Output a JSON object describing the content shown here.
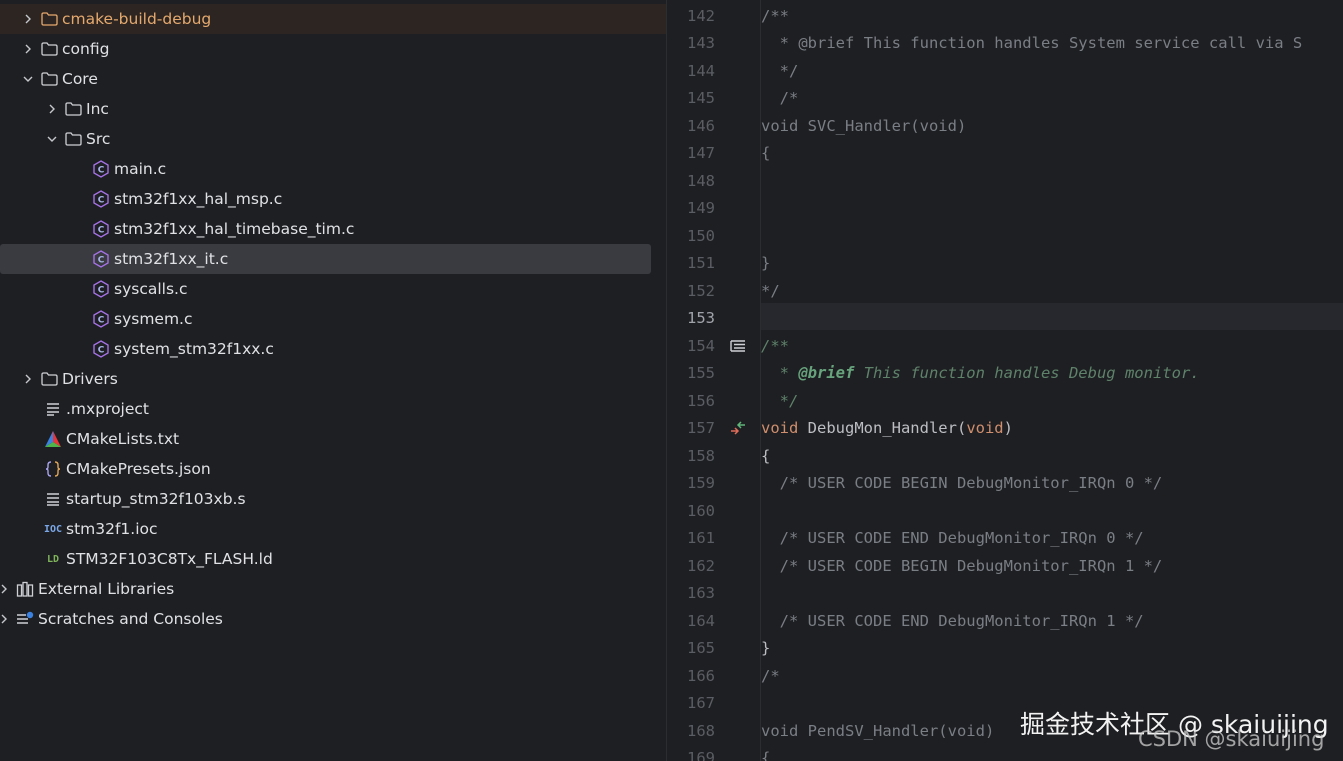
{
  "project_tree": {
    "items": [
      {
        "label": "cmake-build-debug",
        "icon": "folder-icon"
      },
      {
        "label": "config",
        "icon": "folder-icon"
      },
      {
        "label": "Core",
        "icon": "folder-icon"
      },
      {
        "label": "Inc",
        "icon": "folder-icon"
      },
      {
        "label": "Src",
        "icon": "folder-icon"
      },
      {
        "label": "main.c",
        "icon": "c-file-icon"
      },
      {
        "label": "stm32f1xx_hal_msp.c",
        "icon": "c-file-icon"
      },
      {
        "label": "stm32f1xx_hal_timebase_tim.c",
        "icon": "c-file-icon"
      },
      {
        "label": "stm32f1xx_it.c",
        "icon": "c-file-icon"
      },
      {
        "label": "syscalls.c",
        "icon": "c-file-icon"
      },
      {
        "label": "sysmem.c",
        "icon": "c-file-icon"
      },
      {
        "label": "system_stm32f1xx.c",
        "icon": "c-file-icon"
      },
      {
        "label": "Drivers",
        "icon": "folder-icon"
      },
      {
        "label": ".mxproject",
        "icon": "text-file-icon"
      },
      {
        "label": "CMakeLists.txt",
        "icon": "cmake-icon"
      },
      {
        "label": "CMakePresets.json",
        "icon": "json-file-icon"
      },
      {
        "label": "startup_stm32f103xb.s",
        "icon": "asm-file-icon"
      },
      {
        "label": "stm32f1.ioc",
        "icon": "ioc-file-icon"
      },
      {
        "label": "STM32F103C8Tx_FLASH.ld",
        "icon": "ld-file-icon"
      },
      {
        "label": "External Libraries",
        "icon": "library-icon"
      },
      {
        "label": "Scratches and Consoles",
        "icon": "scratches-icon"
      }
    ],
    "ioc_icon_text": "IOC",
    "ld_icon_text": "LD",
    "selected": "stm32f1xx_it.c"
  },
  "editor": {
    "current_line": "153",
    "lines": [
      {
        "n": "142",
        "text": "/**"
      },
      {
        "n": "143",
        "text": "  * @brief This function handles System service call via S"
      },
      {
        "n": "144",
        "text": "  */"
      },
      {
        "n": "145",
        "text": "  /*"
      },
      {
        "n": "146",
        "text": "void SVC_Handler(void)"
      },
      {
        "n": "147",
        "text": "{"
      },
      {
        "n": "148",
        "text": ""
      },
      {
        "n": "149",
        "text": ""
      },
      {
        "n": "150",
        "text": ""
      },
      {
        "n": "151",
        "text": "}"
      },
      {
        "n": "152",
        "text": "*/"
      },
      {
        "n": "153",
        "text": ""
      },
      {
        "n": "154",
        "text": "/**"
      },
      {
        "n": "155",
        "text": "  * @brief This function handles Debug monitor."
      },
      {
        "n": "156",
        "text": "  */"
      },
      {
        "n": "157",
        "text": "void DebugMon_Handler(void)"
      },
      {
        "n": "158",
        "text": "{"
      },
      {
        "n": "159",
        "text": "  /* USER CODE BEGIN DebugMonitor_IRQn 0 */"
      },
      {
        "n": "160",
        "text": ""
      },
      {
        "n": "161",
        "text": "  /* USER CODE END DebugMonitor_IRQn 0 */"
      },
      {
        "n": "162",
        "text": "  /* USER CODE BEGIN DebugMonitor_IRQn 1 */"
      },
      {
        "n": "163",
        "text": ""
      },
      {
        "n": "164",
        "text": "  /* USER CODE END DebugMonitor_IRQn 1 */"
      },
      {
        "n": "165",
        "text": "}"
      },
      {
        "n": "166",
        "text": "/*"
      },
      {
        "n": "167",
        "text": ""
      },
      {
        "n": "168",
        "text": "void PendSV_Handler(void)"
      },
      {
        "n": "169",
        "text": "{"
      }
    ],
    "colors": {
      "comment": "#7a7e85",
      "doc_comment": "#5f826b",
      "keyword": "#cf8e6d",
      "function": "#56a8f5",
      "text": "#bcbec4"
    }
  },
  "watermark": {
    "line1": "掘金技术社区 @ skaiuijing",
    "line2": "CSDN @skaiuijing"
  }
}
